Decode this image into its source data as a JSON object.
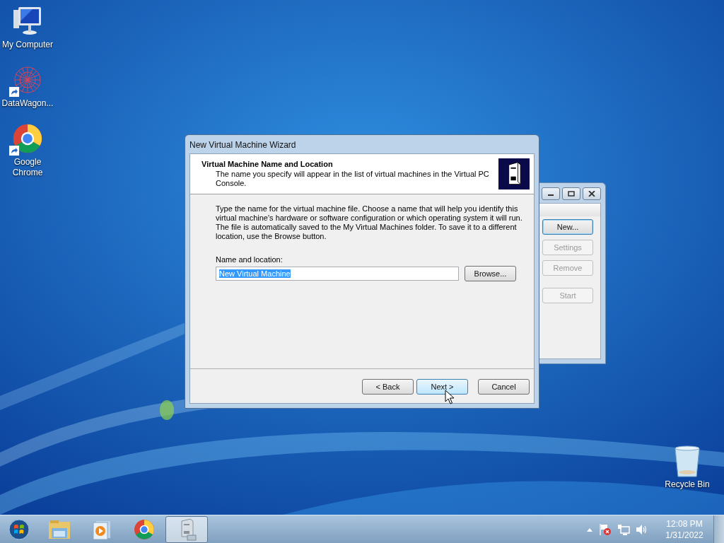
{
  "desktop_icons": [
    {
      "kind": "computer",
      "label": "My Computer",
      "shortcut": false
    },
    {
      "kind": "network",
      "label": "DataWagon...",
      "shortcut": true
    },
    {
      "kind": "chrome",
      "label": "Google Chrome",
      "shortcut": true
    }
  ],
  "recycle_bin": {
    "label": "Recycle Bin"
  },
  "console_window": {
    "buttons": [
      {
        "label": "New...",
        "disabled": false,
        "focused": true
      },
      {
        "label": "Settings",
        "disabled": true,
        "focused": false
      },
      {
        "label": "Remove",
        "disabled": true,
        "focused": false
      },
      {
        "label": "Start",
        "disabled": true,
        "focused": false
      }
    ]
  },
  "wizard": {
    "title": "New Virtual Machine Wizard",
    "heading": "Virtual Machine Name and Location",
    "subheading": "The name you specify will appear in the list of virtual machines in the Virtual PC Console.",
    "instructions": "Type the name for the virtual machine file. Choose a name that will help you identify this virtual machine's hardware or software configuration or which operating system it will run. The file is automatically saved to the My Virtual Machines folder. To save it to a different location, use the Browse button.",
    "field_label": "Name and location:",
    "field_value": "New Virtual Machine",
    "value_selected": true,
    "browse_button": "Browse...",
    "buttons": [
      {
        "label": "< Back",
        "hovered": false
      },
      {
        "label": "Next >",
        "hovered": true
      },
      {
        "label": "Cancel",
        "hovered": false
      }
    ]
  },
  "taskbar": {
    "items": [
      {
        "kind": "folder",
        "selected": false
      },
      {
        "kind": "media",
        "selected": false
      },
      {
        "kind": "chrome",
        "selected": false
      },
      {
        "kind": "vpc",
        "selected": true
      }
    ],
    "time": "12:08 PM",
    "date": "1/31/2022"
  }
}
